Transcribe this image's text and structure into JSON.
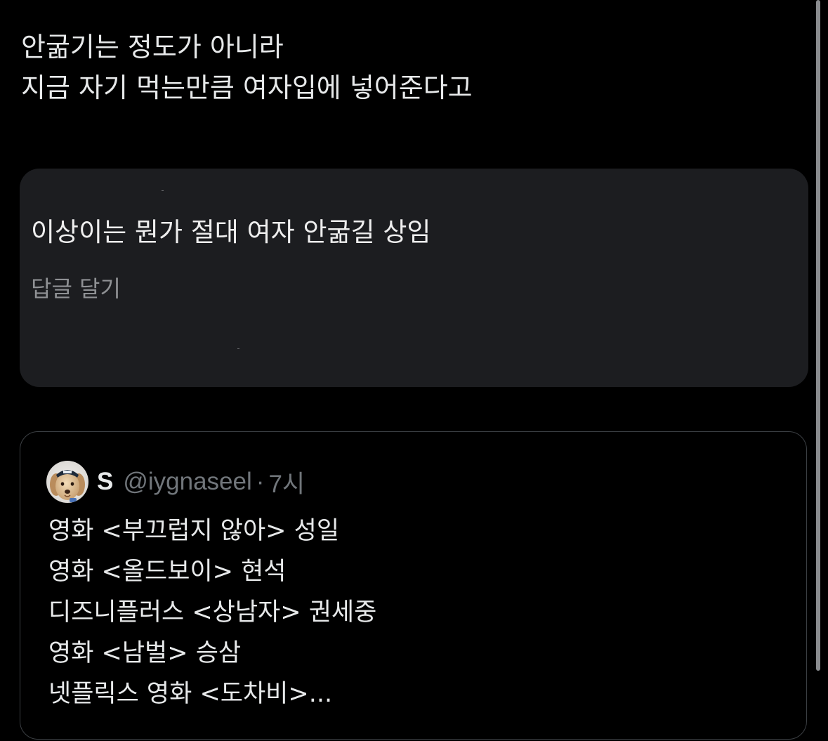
{
  "post": {
    "lines": [
      "안굶기는 정도가 아니라",
      "지금 자기 먹는만큼 여자입에 넣어준다고"
    ]
  },
  "embedded_comment": {
    "text": "이상이는 뭔가 절대 여자 안굶길 상임",
    "reply_label": "답글 달기"
  },
  "quoted_post": {
    "author_name": "S",
    "handle": "@iygnaseel",
    "separator": "·",
    "time": "7시",
    "avatar_icon": "dog-avatar-icon",
    "lines": [
      "영화 <부끄럽지 않아> 성일",
      "영화 <올드보이> 현석",
      "디즈니플러스 <상남자> 권세중",
      "영화 <남벌> 승삼",
      "넷플릭스 영화 <도차비>..."
    ]
  },
  "colors": {
    "background": "#000000",
    "text_primary": "#e7e9ea",
    "text_secondary": "#71767b",
    "embed_card_bg": "#1c1d20",
    "quote_border": "#3b3f43"
  }
}
